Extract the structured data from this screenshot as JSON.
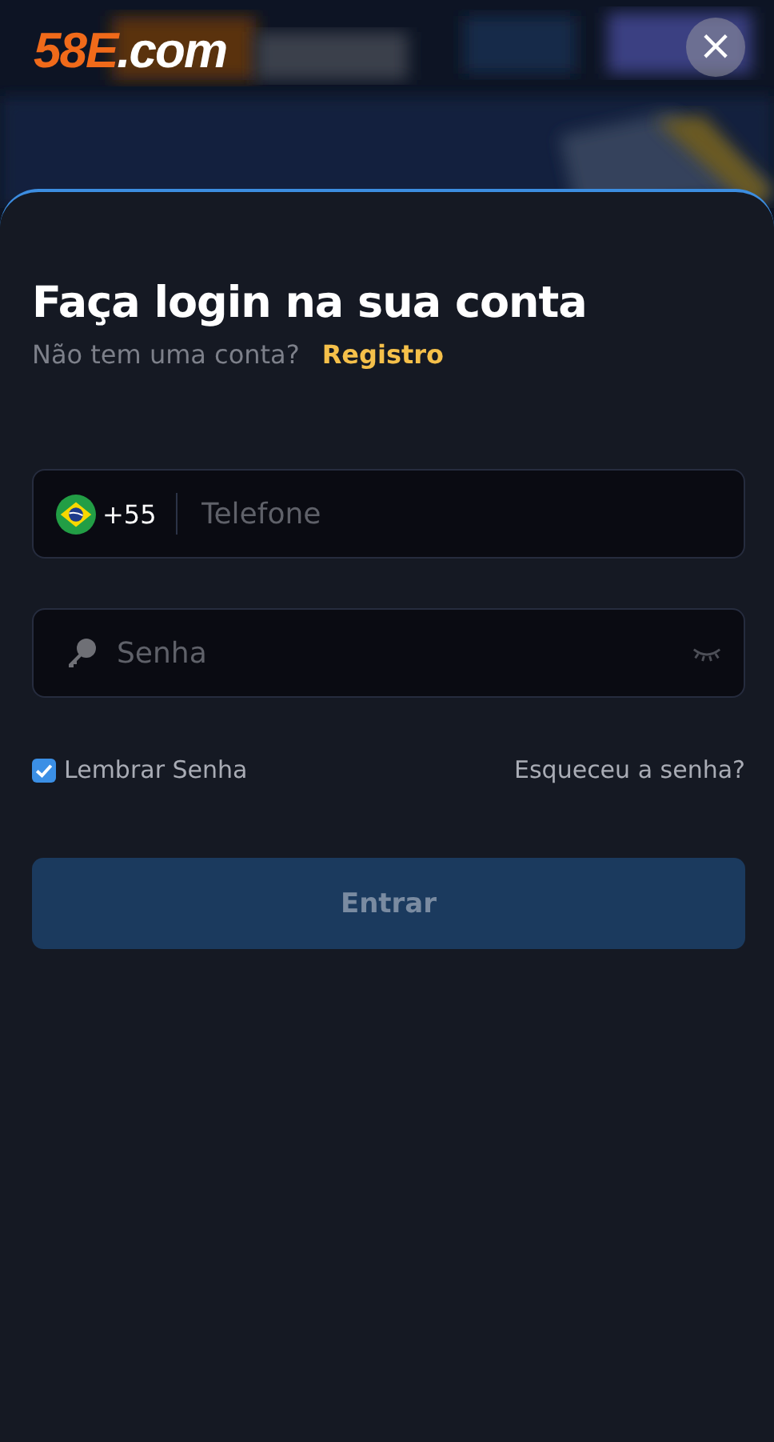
{
  "logo": {
    "brand": "58E",
    "domain": ".com"
  },
  "close_button": {
    "label": "×"
  },
  "login": {
    "title": "Faça login na sua conta",
    "subtitle": "Não tem uma conta?",
    "register_link": "Registro",
    "phone_field": {
      "country_code": "+55",
      "placeholder": "Telefone"
    },
    "password_field": {
      "placeholder": "Senha",
      "visible": false
    },
    "remember": {
      "label": "Lembrar Senha",
      "checked": true
    },
    "forgot_link": "Esqueceu a senha?",
    "submit": {
      "label": "Entrar",
      "disabled": true
    }
  }
}
